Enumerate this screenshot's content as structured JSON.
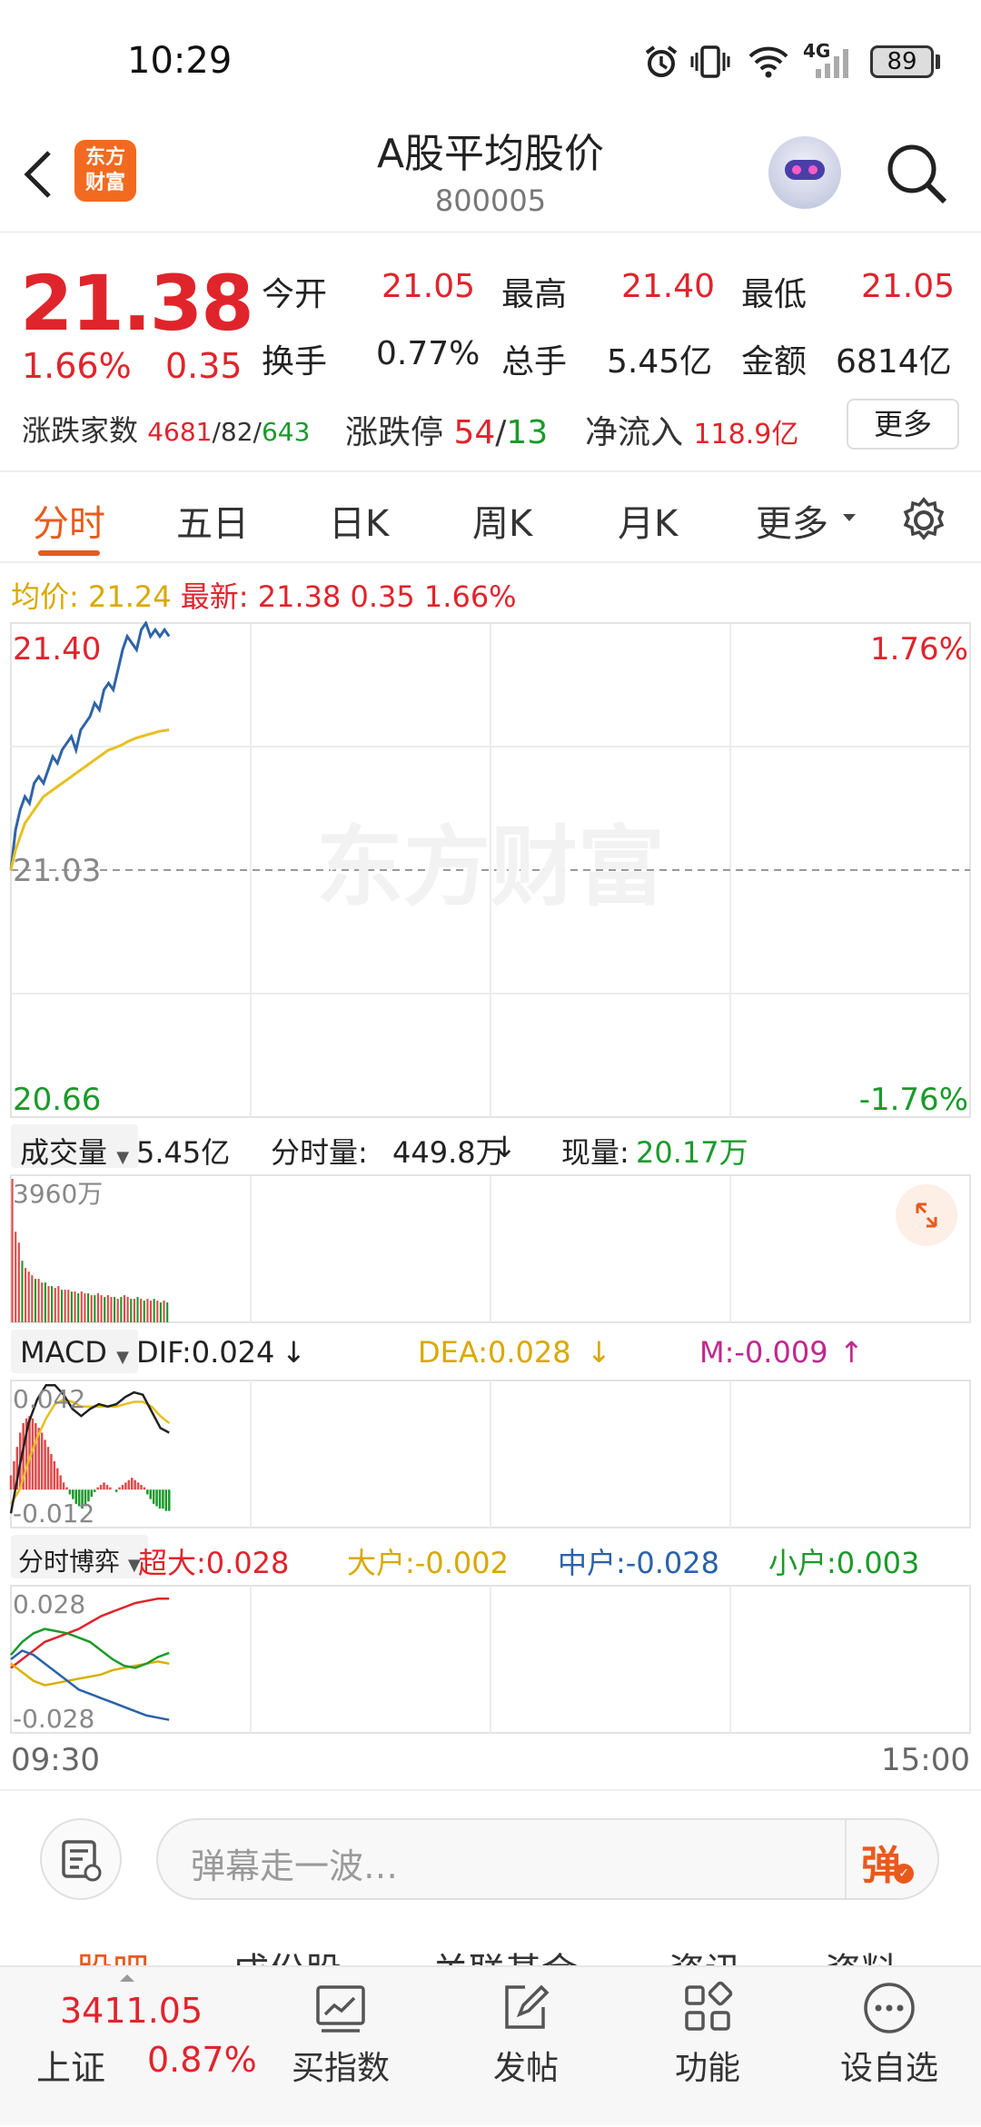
{
  "status_bar": {
    "time": "10:29",
    "battery": "89",
    "network": "4G"
  },
  "header": {
    "back_label": "<",
    "logo_text_line1": "东方",
    "logo_text_line2": "财富",
    "title": "A股平均股价",
    "code": "800005"
  },
  "quote": {
    "price": "21.38",
    "change_pct": "1.66%",
    "change": "0.35",
    "stats": [
      {
        "label": "今开",
        "value": "21.05",
        "color": "red"
      },
      {
        "label": "最高",
        "value": "21.40",
        "color": "red"
      },
      {
        "label": "最低",
        "value": "21.05",
        "color": "red"
      },
      {
        "label": "换手",
        "value": "0.77%",
        "color": "black"
      },
      {
        "label": "总手",
        "value": "5.45亿",
        "color": "black"
      },
      {
        "label": "金额",
        "value": "6814亿",
        "color": "black"
      }
    ],
    "breadth_label": "涨跌家数",
    "breadth_up": "4681",
    "breadth_flat": "82",
    "breadth_down": "643",
    "limit_label": "涨跌停",
    "limit_up": "54",
    "limit_down": "13",
    "inflow_label": "净流入",
    "inflow_value": "118.9亿",
    "more_button": "更多"
  },
  "tabs": [
    {
      "label": "分时",
      "active": true
    },
    {
      "label": "五日",
      "active": false
    },
    {
      "label": "日K",
      "active": false
    },
    {
      "label": "周K",
      "active": false
    },
    {
      "label": "月K",
      "active": false
    },
    {
      "label": "更多",
      "active": false
    }
  ],
  "chart_legend": {
    "avg_label": "均价:",
    "avg_value": "21.24",
    "last_label": "最新:",
    "last_value": "21.38",
    "last_change": "0.35",
    "last_pct": "1.66%"
  },
  "chart_data": [
    {
      "type": "line",
      "name": "intraday",
      "y_left_ticks": [
        "21.40",
        "21.03",
        "20.66"
      ],
      "y_right_ticks": [
        "1.76%",
        "-1.76%"
      ],
      "ylim": [
        20.66,
        21.4
      ],
      "prev_close": 21.03,
      "x_labels": [
        "09:30",
        "15:00"
      ],
      "watermark": "东方财富",
      "series": [
        {
          "color": "#2f63a8",
          "values": [
            21.03,
            21.09,
            21.12,
            21.14,
            21.13,
            21.16,
            21.17,
            21.16,
            21.18,
            21.2,
            21.19,
            21.21,
            21.22,
            21.23,
            21.21,
            21.24,
            21.25,
            21.26,
            21.28,
            21.27,
            21.3,
            21.31,
            21.3,
            21.33,
            21.36,
            21.38,
            21.37,
            21.36,
            21.39,
            21.4,
            21.38,
            21.39,
            21.38,
            21.39,
            21.38
          ]
        },
        {
          "color": "#e6c020",
          "values": [
            21.03,
            21.06,
            21.08,
            21.1,
            21.11,
            21.12,
            21.13,
            21.14,
            21.145,
            21.15,
            21.155,
            21.16,
            21.165,
            21.17,
            21.175,
            21.18,
            21.185,
            21.19,
            21.195,
            21.2,
            21.205,
            21.21,
            21.212,
            21.215,
            21.218,
            21.222,
            21.225,
            21.228,
            21.23,
            21.232,
            21.234,
            21.236,
            21.238,
            21.239,
            21.24
          ]
        }
      ]
    },
    {
      "type": "bar",
      "name": "volume",
      "label": "成交量",
      "total": "5.45亿",
      "minute_label": "分时量:",
      "minute_value": "449.8万",
      "minute_arrow": "↓",
      "current_label": "现量:",
      "current_value": "20.17万",
      "max_label": "3960万",
      "values": [
        39.6,
        25,
        22,
        17,
        15,
        14,
        13,
        12,
        12,
        11,
        11,
        10,
        10,
        9.5,
        10,
        9,
        9,
        9,
        8.5,
        8.5,
        8,
        8.5,
        8,
        8,
        7.5,
        7.5,
        8,
        7.5,
        7,
        7.5,
        7,
        7,
        6.5,
        7,
        7.5,
        7,
        6.5,
        6.5,
        7,
        6.5,
        6,
        6.5,
        6,
        6.5,
        6,
        5.5,
        6,
        5.5
      ],
      "colors": [
        "r",
        "r",
        "r",
        "g",
        "r",
        "r",
        "r",
        "g",
        "r",
        "r",
        "g",
        "r",
        "g",
        "r",
        "r",
        "g",
        "r",
        "r",
        "g",
        "r",
        "g",
        "r",
        "r",
        "g",
        "r",
        "g",
        "r",
        "r",
        "g",
        "r",
        "r",
        "g",
        "r",
        "g",
        "r",
        "r",
        "g",
        "r",
        "g",
        "r",
        "g",
        "r",
        "r",
        "g",
        "r",
        "g",
        "r",
        "g"
      ]
    },
    {
      "type": "line",
      "name": "macd",
      "label": "MACD",
      "dif": "DIF:0.024",
      "dif_arrow": "↓",
      "dea": "DEA:0.028",
      "dea_arrow": "↓",
      "m": "M:-0.009",
      "m_arrow": "↑",
      "y_ticks": [
        "0.042",
        "-0.012"
      ],
      "ylim": [
        -0.016,
        0.046
      ],
      "dif_values": [
        -0.01,
        0.01,
        0.028,
        0.038,
        0.044,
        0.044,
        0.04,
        0.034,
        0.031,
        0.034,
        0.036,
        0.035,
        0.036,
        0.039,
        0.041,
        0.04,
        0.033,
        0.026,
        0.024
      ],
      "dea_values": [
        -0.006,
        0.0,
        0.012,
        0.022,
        0.03,
        0.036,
        0.038,
        0.037,
        0.035,
        0.035,
        0.035,
        0.035,
        0.035,
        0.036,
        0.037,
        0.037,
        0.035,
        0.031,
        0.028
      ],
      "hist_values": [
        0.006,
        0.012,
        0.018,
        0.024,
        0.028,
        0.03,
        0.031,
        0.03,
        0.028,
        0.026,
        0.024,
        0.021,
        0.018,
        0.015,
        0.012,
        0.009,
        0.006,
        0.003,
        0.001,
        -0.002,
        -0.004,
        -0.006,
        -0.007,
        -0.008,
        -0.007,
        -0.005,
        -0.003,
        -0.001,
        0.001,
        0.002,
        0.003,
        0.002,
        0.001,
        0.0,
        -0.001,
        0.001,
        0.002,
        0.003,
        0.004,
        0.005,
        0.004,
        0.003,
        0.002,
        0.001,
        -0.002,
        -0.004,
        -0.006,
        -0.007,
        -0.008,
        -0.008,
        -0.009,
        -0.009
      ]
    },
    {
      "type": "line",
      "name": "fund_flow",
      "label": "分时博弈",
      "y_ticks": [
        "0.028",
        "-0.028"
      ],
      "ylim": [
        -0.034,
        0.034
      ],
      "series": [
        {
          "name": "超大",
          "display": "超大:0.028",
          "color": "#e0242c",
          "values": [
            -0.004,
            0.0,
            0.004,
            0.008,
            0.01,
            0.012,
            0.014,
            0.017,
            0.02,
            0.022,
            0.024,
            0.026,
            0.027,
            0.028,
            0.028
          ]
        },
        {
          "name": "大户",
          "display": "大户:-0.002",
          "color": "#d9b000",
          "values": [
            -0.002,
            -0.006,
            -0.01,
            -0.012,
            -0.011,
            -0.01,
            -0.009,
            -0.008,
            -0.007,
            -0.005,
            -0.004,
            -0.003,
            -0.002,
            -0.001,
            -0.002
          ]
        },
        {
          "name": "中户",
          "display": "中户:-0.028",
          "color": "#2a62a8",
          "values": [
            0.0,
            0.004,
            0.002,
            -0.002,
            -0.006,
            -0.01,
            -0.014,
            -0.016,
            -0.018,
            -0.02,
            -0.022,
            -0.024,
            -0.026,
            -0.027,
            -0.028
          ]
        },
        {
          "name": "小户",
          "display": "小户:0.003",
          "color": "#1a9a2a",
          "values": [
            0.002,
            0.008,
            0.012,
            0.014,
            0.013,
            0.012,
            0.01,
            0.008,
            0.004,
            0.0,
            -0.003,
            -0.004,
            -0.002,
            0.001,
            0.003
          ]
        }
      ]
    }
  ],
  "comment_bar": {
    "placeholder": "弹幕走一波…",
    "danmaku_button": "弹"
  },
  "sub_tabs": [
    "股吧",
    "成份股",
    "关联基金",
    "资讯",
    "资料"
  ],
  "bottom_bar": {
    "index_value": "3411.05",
    "index_name": "上证",
    "index_pct": "0.87%",
    "items": [
      {
        "label": "买指数",
        "icon": "chart-trend-icon"
      },
      {
        "label": "发帖",
        "icon": "edit-icon"
      },
      {
        "label": "功能",
        "icon": "grid-icon"
      },
      {
        "label": "设自选",
        "icon": "more-icon"
      }
    ]
  }
}
